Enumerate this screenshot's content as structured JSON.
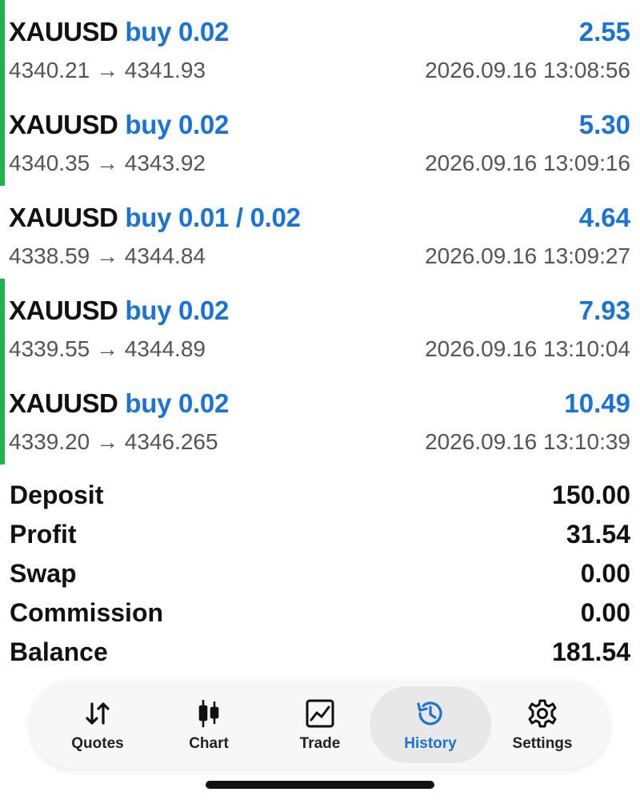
{
  "deals": [
    {
      "symbol": "XAUUSD",
      "direction": "buy 0.02",
      "profit": "2.55",
      "prices": "4340.21 → 4341.93",
      "time": "2026.09.16 13:08:56"
    },
    {
      "symbol": "XAUUSD",
      "direction": "buy 0.02",
      "profit": "5.30",
      "prices": "4340.35 → 4343.92",
      "time": "2026.09.16 13:09:16"
    },
    {
      "symbol": "XAUUSD",
      "direction": "buy 0.01 / 0.02",
      "profit": "4.64",
      "prices": "4338.59 → 4344.84",
      "time": "2026.09.16 13:09:27"
    },
    {
      "symbol": "XAUUSD",
      "direction": "buy 0.02",
      "profit": "7.93",
      "prices": "4339.55 → 4344.89",
      "time": "2026.09.16 13:10:04"
    },
    {
      "symbol": "XAUUSD",
      "direction": "buy 0.02",
      "profit": "10.49",
      "prices": "4339.20 → 4346.265",
      "time": "2026.09.16 13:10:39"
    }
  ],
  "summary": {
    "deposit": {
      "label": "Deposit",
      "value": "150.00"
    },
    "profit": {
      "label": "Profit",
      "value": "31.54"
    },
    "swap": {
      "label": "Swap",
      "value": "0.00"
    },
    "commission": {
      "label": "Commission",
      "value": "0.00"
    },
    "balance": {
      "label": "Balance",
      "value": "181.54"
    }
  },
  "tabs": {
    "quotes": {
      "label": "Quotes",
      "icon": "quotes-arrows-icon"
    },
    "chart": {
      "label": "Chart",
      "icon": "candlestick-icon"
    },
    "trade": {
      "label": "Trade",
      "icon": "trade-chart-icon"
    },
    "history": {
      "label": "History",
      "icon": "history-clock-icon",
      "active": true
    },
    "settings": {
      "label": "Settings",
      "icon": "gear-icon"
    }
  },
  "colors": {
    "accent_blue": "#1a73d6",
    "buy_bar_green": "#22b24c",
    "text_dark": "#111111",
    "text_gray": "#555555"
  }
}
